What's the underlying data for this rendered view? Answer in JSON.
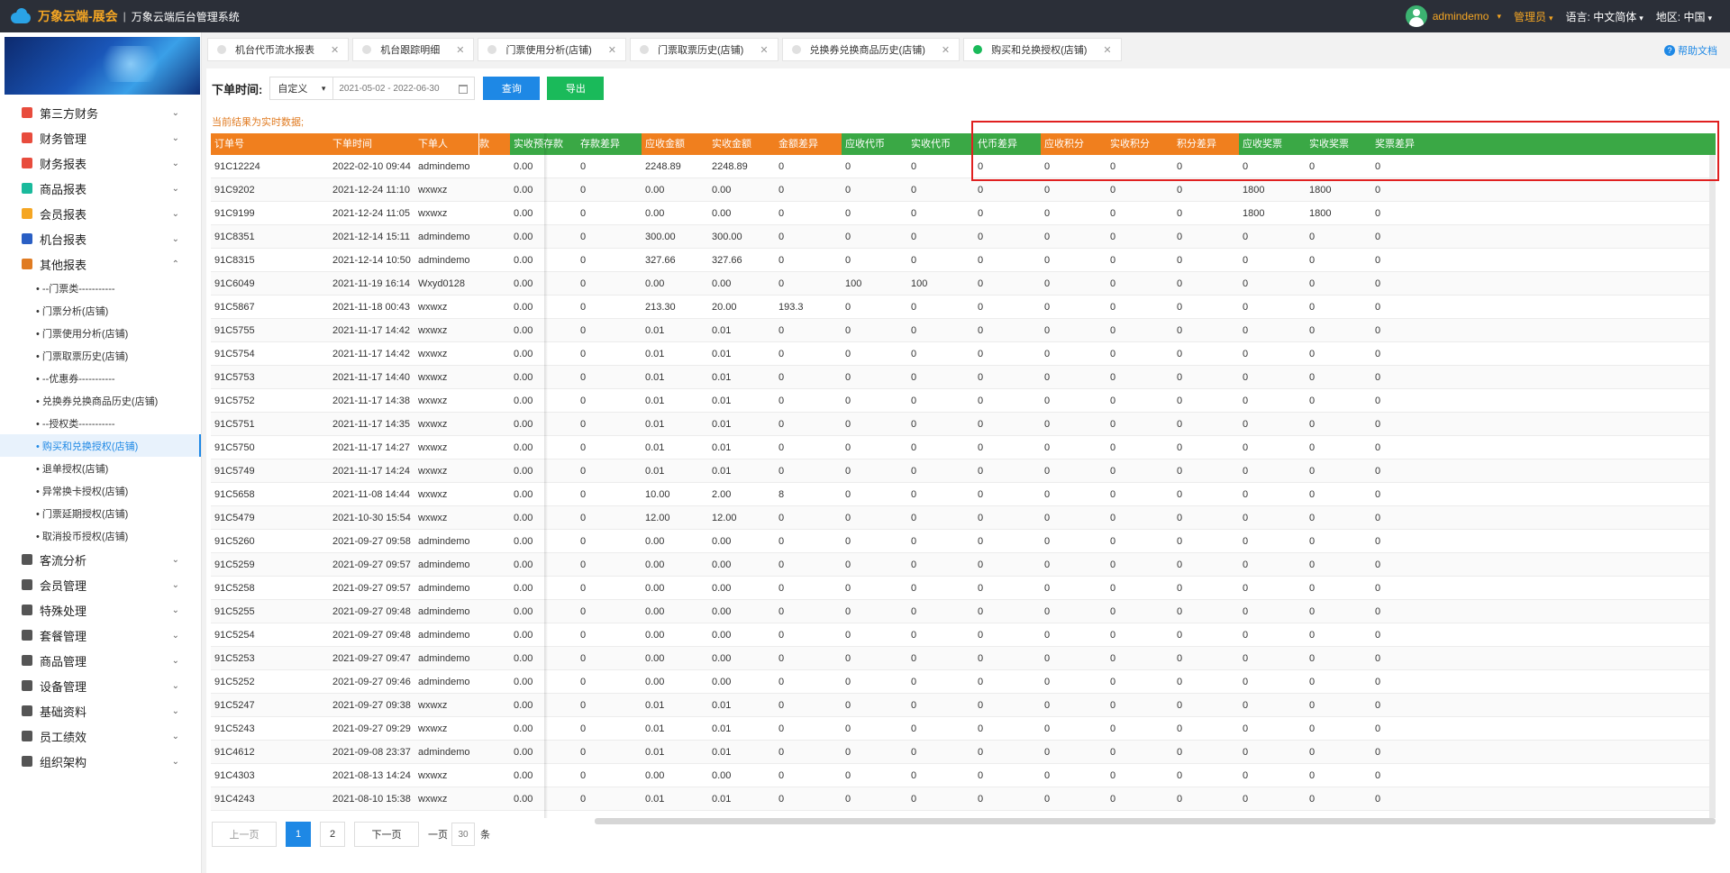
{
  "header": {
    "logo_title": "万象云端-展会",
    "separator": "|",
    "subtitle": "万象云端后台管理系统",
    "user": "admindemo",
    "role": "管理员",
    "language_label": "语言:",
    "language_value": "中文简体",
    "region_label": "地区:",
    "region_value": "中国"
  },
  "sidebar": {
    "groups_top": [
      {
        "label": "第三方财务",
        "icon_color": "#e84c3d"
      },
      {
        "label": "财务管理",
        "icon_color": "#e84c3d"
      },
      {
        "label": "财务报表",
        "icon_color": "#e84c3d"
      },
      {
        "label": "商品报表",
        "icon_color": "#1aba9c"
      },
      {
        "label": "会员报表",
        "icon_color": "#f5a623"
      },
      {
        "label": "机台报表",
        "icon_color": "#2a5fc4"
      },
      {
        "label": "其他报表",
        "icon_color": "#e07b22"
      }
    ],
    "sub_items": [
      "• --门票类-----------",
      "• 门票分析(店铺)",
      "• 门票使用分析(店铺)",
      "• 门票取票历史(店铺)",
      "• --优惠券-----------",
      "• 兑换券兑换商品历史(店铺)",
      "• --授权类-----------",
      "• 购买和兑换授权(店铺)",
      "• 退单授权(店铺)",
      "• 异常换卡授权(店铺)",
      "• 门票延期授权(店铺)",
      "• 取消投币授权(店铺)"
    ],
    "active_sub_index": 7,
    "groups_bottom": [
      {
        "label": "客流分析",
        "icon_color": "#555"
      },
      {
        "label": "会员管理",
        "icon_color": "#555"
      },
      {
        "label": "特殊处理",
        "icon_color": "#555"
      },
      {
        "label": "套餐管理",
        "icon_color": "#555"
      },
      {
        "label": "商品管理",
        "icon_color": "#555"
      },
      {
        "label": "设备管理",
        "icon_color": "#555"
      },
      {
        "label": "基础资料",
        "icon_color": "#555"
      },
      {
        "label": "员工绩效",
        "icon_color": "#555"
      },
      {
        "label": "组织架构",
        "icon_color": "#555"
      }
    ]
  },
  "tabs": [
    {
      "label": "机台代币流水报表",
      "active": false
    },
    {
      "label": "机台跟踪明细",
      "active": false
    },
    {
      "label": "门票使用分析(店铺)",
      "active": false
    },
    {
      "label": "门票取票历史(店铺)",
      "active": false
    },
    {
      "label": "兑换券兑换商品历史(店铺)",
      "active": false
    },
    {
      "label": "购买和兑换授权(店铺)",
      "active": true
    }
  ],
  "help_label": "帮助文档",
  "filter": {
    "label": "下单时间:",
    "mode": "自定义",
    "date_range": "2021-05-02 - 2022-06-30",
    "query_label": "查询",
    "export_label": "导出"
  },
  "notice": "当前结果为实时数据;",
  "colors": {
    "orange": "#f07f1e",
    "green": "#3aa845",
    "blue": "#1e88e5"
  },
  "table": {
    "columns": [
      {
        "label": "订单号",
        "color": "orange"
      },
      {
        "label": "下单时间",
        "color": "orange"
      },
      {
        "label": "下单人",
        "color": "orange"
      },
      {
        "label": "款",
        "color": "orange"
      },
      {
        "label": "实收预存款",
        "color": "green"
      },
      {
        "label": "存款差异",
        "color": "green"
      },
      {
        "label": "应收金额",
        "color": "orange"
      },
      {
        "label": "实收金额",
        "color": "orange"
      },
      {
        "label": "金额差异",
        "color": "orange"
      },
      {
        "label": "应收代币",
        "color": "green"
      },
      {
        "label": "实收代币",
        "color": "green"
      },
      {
        "label": "代币差异",
        "color": "green"
      },
      {
        "label": "应收积分",
        "color": "orange"
      },
      {
        "label": "实收积分",
        "color": "orange"
      },
      {
        "label": "积分差异",
        "color": "orange"
      },
      {
        "label": "应收奖票",
        "color": "green"
      },
      {
        "label": "实收奖票",
        "color": "green"
      },
      {
        "label": "奖票差异",
        "color": "green"
      }
    ],
    "rows": [
      [
        "91C12224",
        "2022-02-10 09:44",
        "admindemo",
        "",
        "0.00",
        "0",
        "2248.89",
        "2248.89",
        "0",
        "0",
        "0",
        "0",
        "0",
        "0",
        "0",
        "0",
        "0",
        "0"
      ],
      [
        "91C9202",
        "2021-12-24 11:10",
        "wxwxz",
        "",
        "0.00",
        "0",
        "0.00",
        "0.00",
        "0",
        "0",
        "0",
        "0",
        "0",
        "0",
        "0",
        "1800",
        "1800",
        "0"
      ],
      [
        "91C9199",
        "2021-12-24 11:05",
        "wxwxz",
        "",
        "0.00",
        "0",
        "0.00",
        "0.00",
        "0",
        "0",
        "0",
        "0",
        "0",
        "0",
        "0",
        "1800",
        "1800",
        "0"
      ],
      [
        "91C8351",
        "2021-12-14 15:11",
        "admindemo",
        "",
        "0.00",
        "0",
        "300.00",
        "300.00",
        "0",
        "0",
        "0",
        "0",
        "0",
        "0",
        "0",
        "0",
        "0",
        "0"
      ],
      [
        "91C8315",
        "2021-12-14 10:50",
        "admindemo",
        "",
        "0.00",
        "0",
        "327.66",
        "327.66",
        "0",
        "0",
        "0",
        "0",
        "0",
        "0",
        "0",
        "0",
        "0",
        "0"
      ],
      [
        "91C6049",
        "2021-11-19 16:14",
        "Wxyd0128",
        "",
        "0.00",
        "0",
        "0.00",
        "0.00",
        "0",
        "100",
        "100",
        "0",
        "0",
        "0",
        "0",
        "0",
        "0",
        "0"
      ],
      [
        "91C5867",
        "2021-11-18 00:43",
        "wxwxz",
        "",
        "0.00",
        "0",
        "213.30",
        "20.00",
        "193.3",
        "0",
        "0",
        "0",
        "0",
        "0",
        "0",
        "0",
        "0",
        "0"
      ],
      [
        "91C5755",
        "2021-11-17 14:42",
        "wxwxz",
        "",
        "0.00",
        "0",
        "0.01",
        "0.01",
        "0",
        "0",
        "0",
        "0",
        "0",
        "0",
        "0",
        "0",
        "0",
        "0"
      ],
      [
        "91C5754",
        "2021-11-17 14:42",
        "wxwxz",
        "",
        "0.00",
        "0",
        "0.01",
        "0.01",
        "0",
        "0",
        "0",
        "0",
        "0",
        "0",
        "0",
        "0",
        "0",
        "0"
      ],
      [
        "91C5753",
        "2021-11-17 14:40",
        "wxwxz",
        "",
        "0.00",
        "0",
        "0.01",
        "0.01",
        "0",
        "0",
        "0",
        "0",
        "0",
        "0",
        "0",
        "0",
        "0",
        "0"
      ],
      [
        "91C5752",
        "2021-11-17 14:38",
        "wxwxz",
        "",
        "0.00",
        "0",
        "0.01",
        "0.01",
        "0",
        "0",
        "0",
        "0",
        "0",
        "0",
        "0",
        "0",
        "0",
        "0"
      ],
      [
        "91C5751",
        "2021-11-17 14:35",
        "wxwxz",
        "",
        "0.00",
        "0",
        "0.01",
        "0.01",
        "0",
        "0",
        "0",
        "0",
        "0",
        "0",
        "0",
        "0",
        "0",
        "0"
      ],
      [
        "91C5750",
        "2021-11-17 14:27",
        "wxwxz",
        "",
        "0.00",
        "0",
        "0.01",
        "0.01",
        "0",
        "0",
        "0",
        "0",
        "0",
        "0",
        "0",
        "0",
        "0",
        "0"
      ],
      [
        "91C5749",
        "2021-11-17 14:24",
        "wxwxz",
        "",
        "0.00",
        "0",
        "0.01",
        "0.01",
        "0",
        "0",
        "0",
        "0",
        "0",
        "0",
        "0",
        "0",
        "0",
        "0"
      ],
      [
        "91C5658",
        "2021-11-08 14:44",
        "wxwxz",
        "",
        "0.00",
        "0",
        "10.00",
        "2.00",
        "8",
        "0",
        "0",
        "0",
        "0",
        "0",
        "0",
        "0",
        "0",
        "0"
      ],
      [
        "91C5479",
        "2021-10-30 15:54",
        "wxwxz",
        "",
        "0.00",
        "0",
        "12.00",
        "12.00",
        "0",
        "0",
        "0",
        "0",
        "0",
        "0",
        "0",
        "0",
        "0",
        "0"
      ],
      [
        "91C5260",
        "2021-09-27 09:58",
        "admindemo",
        "",
        "0.00",
        "0",
        "0.00",
        "0.00",
        "0",
        "0",
        "0",
        "0",
        "0",
        "0",
        "0",
        "0",
        "0",
        "0"
      ],
      [
        "91C5259",
        "2021-09-27 09:57",
        "admindemo",
        "",
        "0.00",
        "0",
        "0.00",
        "0.00",
        "0",
        "0",
        "0",
        "0",
        "0",
        "0",
        "0",
        "0",
        "0",
        "0"
      ],
      [
        "91C5258",
        "2021-09-27 09:57",
        "admindemo",
        "",
        "0.00",
        "0",
        "0.00",
        "0.00",
        "0",
        "0",
        "0",
        "0",
        "0",
        "0",
        "0",
        "0",
        "0",
        "0"
      ],
      [
        "91C5255",
        "2021-09-27 09:48",
        "admindemo",
        "",
        "0.00",
        "0",
        "0.00",
        "0.00",
        "0",
        "0",
        "0",
        "0",
        "0",
        "0",
        "0",
        "0",
        "0",
        "0"
      ],
      [
        "91C5254",
        "2021-09-27 09:48",
        "admindemo",
        "",
        "0.00",
        "0",
        "0.00",
        "0.00",
        "0",
        "0",
        "0",
        "0",
        "0",
        "0",
        "0",
        "0",
        "0",
        "0"
      ],
      [
        "91C5253",
        "2021-09-27 09:47",
        "admindemo",
        "",
        "0.00",
        "0",
        "0.00",
        "0.00",
        "0",
        "0",
        "0",
        "0",
        "0",
        "0",
        "0",
        "0",
        "0",
        "0"
      ],
      [
        "91C5252",
        "2021-09-27 09:46",
        "admindemo",
        "",
        "0.00",
        "0",
        "0.00",
        "0.00",
        "0",
        "0",
        "0",
        "0",
        "0",
        "0",
        "0",
        "0",
        "0",
        "0"
      ],
      [
        "91C5247",
        "2021-09-27 09:38",
        "wxwxz",
        "",
        "0.00",
        "0",
        "0.01",
        "0.01",
        "0",
        "0",
        "0",
        "0",
        "0",
        "0",
        "0",
        "0",
        "0",
        "0"
      ],
      [
        "91C5243",
        "2021-09-27 09:29",
        "wxwxz",
        "",
        "0.00",
        "0",
        "0.01",
        "0.01",
        "0",
        "0",
        "0",
        "0",
        "0",
        "0",
        "0",
        "0",
        "0",
        "0"
      ],
      [
        "91C4612",
        "2021-09-08 23:37",
        "admindemo",
        "",
        "0.00",
        "0",
        "0.01",
        "0.01",
        "0",
        "0",
        "0",
        "0",
        "0",
        "0",
        "0",
        "0",
        "0",
        "0"
      ],
      [
        "91C4303",
        "2021-08-13 14:24",
        "wxwxz",
        "",
        "0.00",
        "0",
        "0.00",
        "0.00",
        "0",
        "0",
        "0",
        "0",
        "0",
        "0",
        "0",
        "0",
        "0",
        "0"
      ],
      [
        "91C4243",
        "2021-08-10 15:38",
        "wxwxz",
        "",
        "0.00",
        "0",
        "0.01",
        "0.01",
        "0",
        "0",
        "0",
        "0",
        "0",
        "0",
        "0",
        "0",
        "0",
        "0"
      ]
    ]
  },
  "pager": {
    "prev_label": "上一页",
    "pages": [
      "1",
      "2"
    ],
    "current_page": "1",
    "next_label": "下一页",
    "size_label": "一页",
    "size_value": "30",
    "unit_label": "条"
  }
}
